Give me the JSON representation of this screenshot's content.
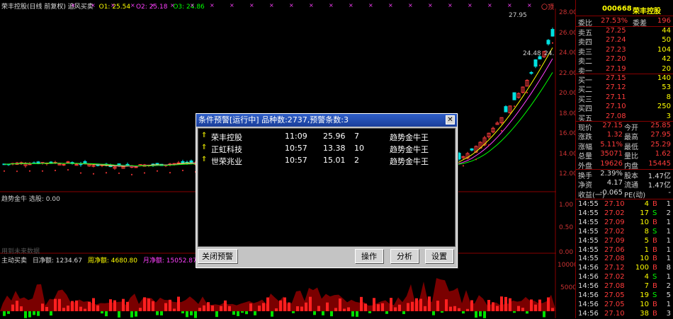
{
  "chart_header": {
    "title": "荣丰控股(日线 前复权) 追风买卖",
    "o1": "O1: 25.54",
    "o2": "O2: 25.18",
    "o3": "O3: 24.86"
  },
  "price_axis": [
    "28.00",
    "26.00",
    "24.00",
    "22.00",
    "20.00",
    "18.00",
    "16.00",
    "14.00",
    "12.00"
  ],
  "indicator_header": "趋势金牛  选股: 0.00",
  "indicator_axis": [
    "1.00",
    "0.50",
    "0.00"
  ],
  "fund_header": {
    "name": "主动买卖",
    "daily": "日净额: 1234.67",
    "weekly": "周净额: 4680.80",
    "monthly": "月净额: 15052.87"
  },
  "fund_axis": [
    "10000",
    "5000"
  ],
  "faint_label": "用到未来数据",
  "hint_label": "〇顶",
  "chart_annotations": {
    "high": "27.95",
    "low": "24.48",
    "low_tail": "24."
  },
  "quote": {
    "code": "000668",
    "name": "荣丰控股",
    "weibi_label": "委比",
    "weibi_value": "27.53%",
    "weicha_label": "委差",
    "weicha_value": "196",
    "asks": [
      {
        "label": "卖五",
        "price": "27.25",
        "vol": "44"
      },
      {
        "label": "卖四",
        "price": "27.24",
        "vol": "50"
      },
      {
        "label": "卖三",
        "price": "27.23",
        "vol": "104"
      },
      {
        "label": "卖二",
        "price": "27.20",
        "vol": "42"
      },
      {
        "label": "卖一",
        "price": "27.19",
        "vol": "20"
      }
    ],
    "bids": [
      {
        "label": "买一",
        "price": "27.15",
        "vol": "140"
      },
      {
        "label": "买二",
        "price": "27.12",
        "vol": "53"
      },
      {
        "label": "买三",
        "price": "27.11",
        "vol": "8"
      },
      {
        "label": "买四",
        "price": "27.10",
        "vol": "250"
      },
      {
        "label": "买五",
        "price": "27.08",
        "vol": "3"
      }
    ],
    "stats": [
      {
        "l1": "现价",
        "v1": "27.15",
        "l2": "今开",
        "v2": "25.85"
      },
      {
        "l1": "涨跌",
        "v1": "1.32",
        "l2": "最高",
        "v2": "27.95"
      },
      {
        "l1": "涨幅",
        "v1": "5.11%",
        "l2": "最低",
        "v2": "25.29"
      },
      {
        "l1": "总量",
        "v1": "35071",
        "l2": "量比",
        "v2": "1.62"
      },
      {
        "l1": "外盘",
        "v1": "19626",
        "l2": "内盘",
        "v2": "15445"
      }
    ],
    "stats2": [
      {
        "l1": "换手",
        "v1": "2.39%",
        "l2": "股本",
        "v2": "1.47亿"
      },
      {
        "l1": "净资",
        "v1": "4.17",
        "l2": "流通",
        "v2": "1.47亿"
      },
      {
        "l1": "收益(一)",
        "v1": "-0.065",
        "l2": "PE(动)",
        "v2": "-"
      }
    ],
    "ticks": [
      {
        "t": "14:55",
        "p": "27.10",
        "v": "4",
        "d": "B",
        "n": "1"
      },
      {
        "t": "14:55",
        "p": "27.02",
        "v": "17",
        "d": "S",
        "n": "2"
      },
      {
        "t": "14:55",
        "p": "27.09",
        "v": "10",
        "d": "B",
        "n": "1"
      },
      {
        "t": "14:55",
        "p": "27.02",
        "v": "8",
        "d": "S",
        "n": "1"
      },
      {
        "t": "14:55",
        "p": "27.09",
        "v": "5",
        "d": "B",
        "n": "1"
      },
      {
        "t": "14:55",
        "p": "27.06",
        "v": "1",
        "d": "B",
        "n": "1"
      },
      {
        "t": "14:55",
        "p": "27.08",
        "v": "10",
        "d": "B",
        "n": "1"
      },
      {
        "t": "14:56",
        "p": "27.12",
        "v": "100",
        "d": "B",
        "n": "8"
      },
      {
        "t": "14:56",
        "p": "27.02",
        "v": "4",
        "d": "S",
        "n": "1"
      },
      {
        "t": "14:56",
        "p": "27.08",
        "v": "7",
        "d": "B",
        "n": "2"
      },
      {
        "t": "14:56",
        "p": "27.05",
        "v": "19",
        "d": "S",
        "n": "5"
      },
      {
        "t": "14:56",
        "p": "27.05",
        "v": "10",
        "d": "B",
        "n": "1"
      },
      {
        "t": "14:56",
        "p": "27.10",
        "v": "38",
        "d": "B",
        "n": "3"
      }
    ]
  },
  "dialog": {
    "title": "条件预警[运行中] 品种数:2737,预警条数:3",
    "close": "✕",
    "alerts": [
      {
        "name": "荣丰控股",
        "time": "11:09",
        "price": "25.96",
        "count": "7",
        "cond": "趋势金牛王"
      },
      {
        "name": "正虹科技",
        "time": "10:57",
        "price": "13.38",
        "count": "10",
        "cond": "趋势金牛王"
      },
      {
        "name": "世荣兆业",
        "time": "10:57",
        "price": "15.01",
        "count": "2",
        "cond": "趋势金牛王"
      }
    ],
    "buttons": {
      "close_alert": "关闭预警",
      "operate": "操作",
      "analyze": "分析",
      "settings": "设置"
    }
  },
  "colors": {
    "up": "#ff3b3b",
    "down": "#00e0e0",
    "label_yellow": "#e8e800",
    "accent_purple": "#ff40ff",
    "green": "#00ff00"
  }
}
